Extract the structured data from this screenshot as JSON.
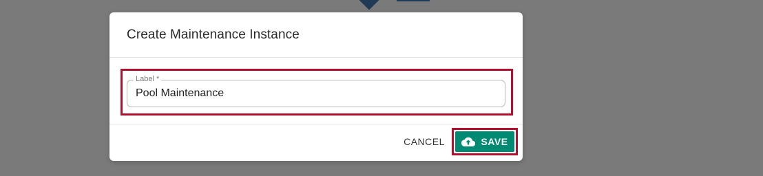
{
  "dialog": {
    "title": "Create Maintenance Instance",
    "label_field": {
      "label": "Label *",
      "value": "Pool Maintenance"
    },
    "actions": {
      "cancel_label": "CANCEL",
      "save_label": "SAVE",
      "save_icon": "cloud-upload-icon"
    }
  },
  "colors": {
    "overlay": "#7a7a7a",
    "save_button": "#008a74",
    "highlight": "#b0102e",
    "background_accent": "#203a55"
  }
}
